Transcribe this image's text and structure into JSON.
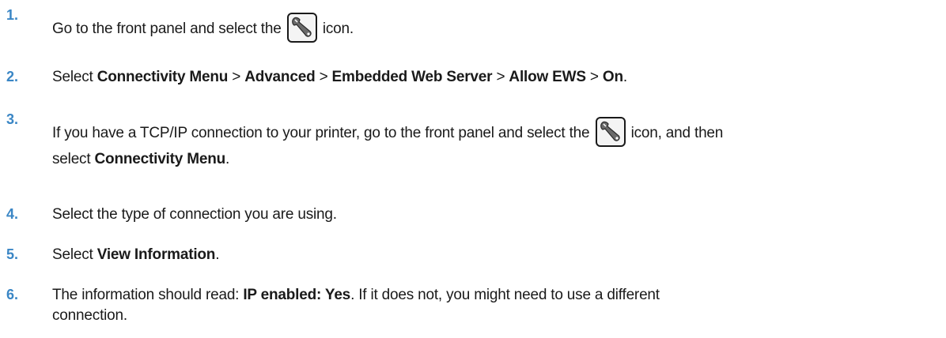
{
  "steps": [
    {
      "number": "1.",
      "before_icon": "Go to the front panel and select the",
      "icon": "wrench-icon",
      "after_icon": "icon."
    },
    {
      "number": "2.",
      "parts": [
        "Select ",
        "Connectivity Menu",
        " > ",
        "Advanced",
        " > ",
        "Embedded Web Server",
        " > ",
        "Allow EWS",
        " > ",
        "On",
        "."
      ]
    },
    {
      "number": "3.",
      "before_icon": "If you have a TCP/IP connection to your printer, go to the front panel and select the",
      "icon": "wrench-icon",
      "after_icon": "icon, and then",
      "line2_prefix": "select ",
      "line2_bold": "Connectivity Menu",
      "line2_suffix": "."
    },
    {
      "number": "4.",
      "text": "Select the type of connection you are using."
    },
    {
      "number": "5.",
      "prefix": "Select ",
      "bold": "View Information",
      "suffix": "."
    },
    {
      "number": "6.",
      "prefix": "The information should read: ",
      "bold": "IP enabled: Yes",
      "suffix": ". If it does not, you might need to use a different",
      "line2": "connection."
    }
  ],
  "colors": {
    "step_number": "#3a86c5",
    "text": "#1a1a1a"
  }
}
